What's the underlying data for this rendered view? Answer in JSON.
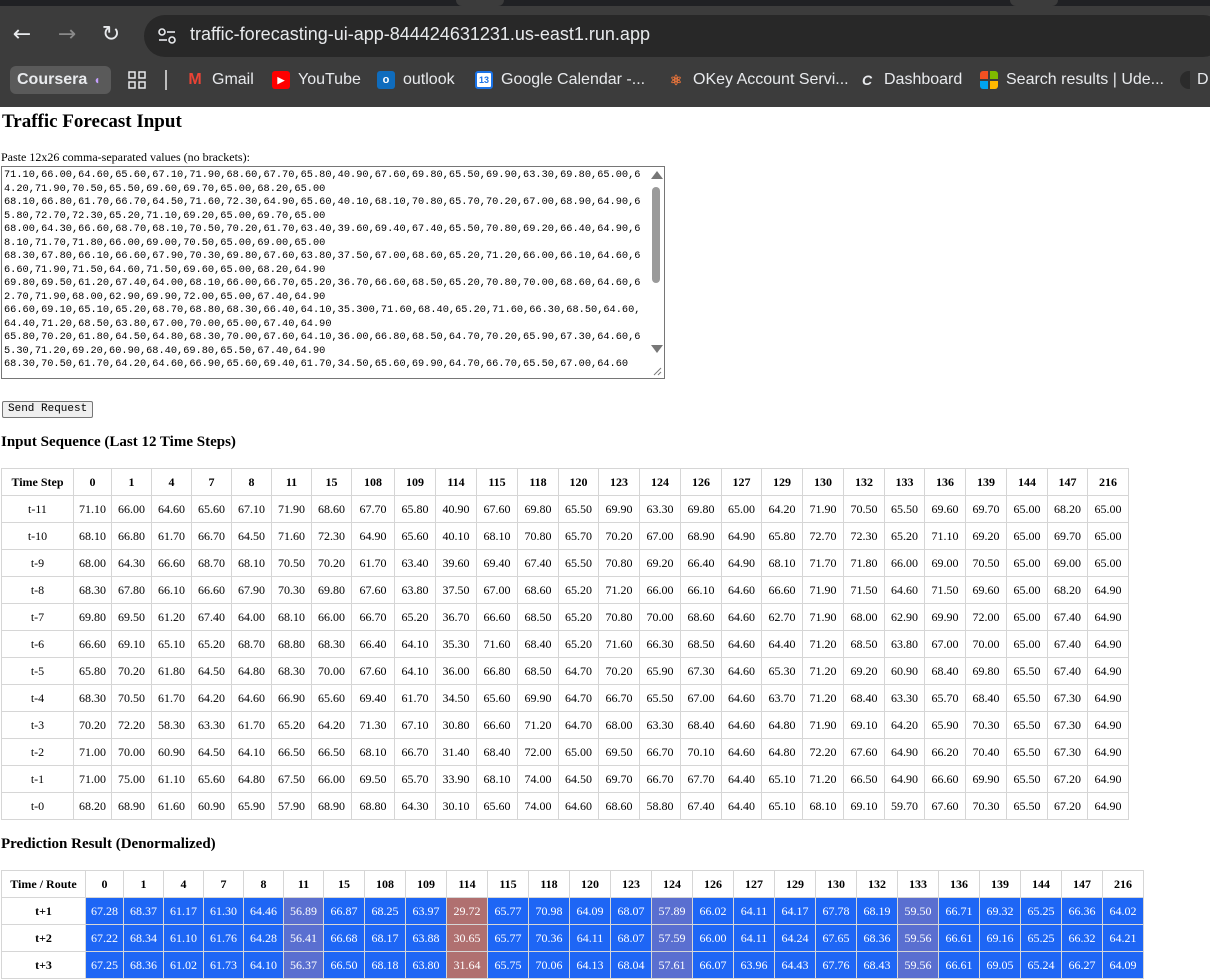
{
  "browser": {
    "url": "traffic-forecasting-ui-app-844424631231.us-east1.run.app",
    "bookmarks": [
      {
        "label": "Coursera",
        "icon": "coursera-icon"
      },
      {
        "label": "",
        "icon": "apps-grid-icon"
      },
      {
        "label": "Gmail",
        "icon": "gmail-icon"
      },
      {
        "label": "YouTube",
        "icon": "youtube-icon"
      },
      {
        "label": "outlook",
        "icon": "outlook-icon"
      },
      {
        "label": "Google Calendar -...",
        "icon": "calendar-icon"
      },
      {
        "label": "OKey Account Servi...",
        "icon": "okey-icon"
      },
      {
        "label": "Dashboard",
        "icon": "canvas-icon"
      },
      {
        "label": "Search results | Ude...",
        "icon": "microsoft-icon"
      },
      {
        "label": "D",
        "icon": "bookmark-icon"
      }
    ]
  },
  "page": {
    "title": "Traffic Forecast Input",
    "paste_label": "Paste 12x26 comma-separated values (no brackets):",
    "textarea_value": "71.10,66.00,64.60,65.60,67.10,71.90,68.60,67.70,65.80,40.90,67.60,69.80,65.50,69.90,63.30,69.80,65.00,64.20,71.90,70.50,65.50,69.60,69.70,65.00,68.20,65.00\n68.10,66.80,61.70,66.70,64.50,71.60,72.30,64.90,65.60,40.10,68.10,70.80,65.70,70.20,67.00,68.90,64.90,65.80,72.70,72.30,65.20,71.10,69.20,65.00,69.70,65.00\n68.00,64.30,66.60,68.70,68.10,70.50,70.20,61.70,63.40,39.60,69.40,67.40,65.50,70.80,69.20,66.40,64.90,68.10,71.70,71.80,66.00,69.00,70.50,65.00,69.00,65.00\n68.30,67.80,66.10,66.60,67.90,70.30,69.80,67.60,63.80,37.50,67.00,68.60,65.20,71.20,66.00,66.10,64.60,66.60,71.90,71.50,64.60,71.50,69.60,65.00,68.20,64.90\n69.80,69.50,61.20,67.40,64.00,68.10,66.00,66.70,65.20,36.70,66.60,68.50,65.20,70.80,70.00,68.60,64.60,62.70,71.90,68.00,62.90,69.90,72.00,65.00,67.40,64.90\n66.60,69.10,65.10,65.20,68.70,68.80,68.30,66.40,64.10,35.300,71.60,68.40,65.20,71.60,66.30,68.50,64.60,64.40,71.20,68.50,63.80,67.00,70.00,65.00,67.40,64.90\n65.80,70.20,61.80,64.50,64.80,68.30,70.00,67.60,64.10,36.00,66.80,68.50,64.70,70.20,65.90,67.30,64.60,65.30,71.20,69.20,60.90,68.40,69.80,65.50,67.40,64.90\n68.30,70.50,61.70,64.20,64.60,66.90,65.60,69.40,61.70,34.50,65.60,69.90,64.70,66.70,65.50,67.00,64.60",
    "send_label": "Send Request",
    "input_heading": "Input Sequence (Last 12 Time Steps)",
    "prediction_heading": "Prediction Result (Denormalized)"
  },
  "input_table": {
    "corner": "Time Step",
    "columns": [
      "0",
      "1",
      "4",
      "7",
      "8",
      "11",
      "15",
      "108",
      "109",
      "114",
      "115",
      "118",
      "120",
      "123",
      "124",
      "126",
      "127",
      "129",
      "130",
      "132",
      "133",
      "136",
      "139",
      "144",
      "147",
      "216"
    ],
    "rows": [
      {
        "label": "t-11",
        "values": [
          "71.10",
          "66.00",
          "64.60",
          "65.60",
          "67.10",
          "71.90",
          "68.60",
          "67.70",
          "65.80",
          "40.90",
          "67.60",
          "69.80",
          "65.50",
          "69.90",
          "63.30",
          "69.80",
          "65.00",
          "64.20",
          "71.90",
          "70.50",
          "65.50",
          "69.60",
          "69.70",
          "65.00",
          "68.20",
          "65.00"
        ]
      },
      {
        "label": "t-10",
        "values": [
          "68.10",
          "66.80",
          "61.70",
          "66.70",
          "64.50",
          "71.60",
          "72.30",
          "64.90",
          "65.60",
          "40.10",
          "68.10",
          "70.80",
          "65.70",
          "70.20",
          "67.00",
          "68.90",
          "64.90",
          "65.80",
          "72.70",
          "72.30",
          "65.20",
          "71.10",
          "69.20",
          "65.00",
          "69.70",
          "65.00"
        ]
      },
      {
        "label": "t-9",
        "values": [
          "68.00",
          "64.30",
          "66.60",
          "68.70",
          "68.10",
          "70.50",
          "70.20",
          "61.70",
          "63.40",
          "39.60",
          "69.40",
          "67.40",
          "65.50",
          "70.80",
          "69.20",
          "66.40",
          "64.90",
          "68.10",
          "71.70",
          "71.80",
          "66.00",
          "69.00",
          "70.50",
          "65.00",
          "69.00",
          "65.00"
        ]
      },
      {
        "label": "t-8",
        "values": [
          "68.30",
          "67.80",
          "66.10",
          "66.60",
          "67.90",
          "70.30",
          "69.80",
          "67.60",
          "63.80",
          "37.50",
          "67.00",
          "68.60",
          "65.20",
          "71.20",
          "66.00",
          "66.10",
          "64.60",
          "66.60",
          "71.90",
          "71.50",
          "64.60",
          "71.50",
          "69.60",
          "65.00",
          "68.20",
          "64.90"
        ]
      },
      {
        "label": "t-7",
        "values": [
          "69.80",
          "69.50",
          "61.20",
          "67.40",
          "64.00",
          "68.10",
          "66.00",
          "66.70",
          "65.20",
          "36.70",
          "66.60",
          "68.50",
          "65.20",
          "70.80",
          "70.00",
          "68.60",
          "64.60",
          "62.70",
          "71.90",
          "68.00",
          "62.90",
          "69.90",
          "72.00",
          "65.00",
          "67.40",
          "64.90"
        ]
      },
      {
        "label": "t-6",
        "values": [
          "66.60",
          "69.10",
          "65.10",
          "65.20",
          "68.70",
          "68.80",
          "68.30",
          "66.40",
          "64.10",
          "35.30",
          "71.60",
          "68.40",
          "65.20",
          "71.60",
          "66.30",
          "68.50",
          "64.60",
          "64.40",
          "71.20",
          "68.50",
          "63.80",
          "67.00",
          "70.00",
          "65.00",
          "67.40",
          "64.90"
        ]
      },
      {
        "label": "t-5",
        "values": [
          "65.80",
          "70.20",
          "61.80",
          "64.50",
          "64.80",
          "68.30",
          "70.00",
          "67.60",
          "64.10",
          "36.00",
          "66.80",
          "68.50",
          "64.70",
          "70.20",
          "65.90",
          "67.30",
          "64.60",
          "65.30",
          "71.20",
          "69.20",
          "60.90",
          "68.40",
          "69.80",
          "65.50",
          "67.40",
          "64.90"
        ]
      },
      {
        "label": "t-4",
        "values": [
          "68.30",
          "70.50",
          "61.70",
          "64.20",
          "64.60",
          "66.90",
          "65.60",
          "69.40",
          "61.70",
          "34.50",
          "65.60",
          "69.90",
          "64.70",
          "66.70",
          "65.50",
          "67.00",
          "64.60",
          "63.70",
          "71.20",
          "68.40",
          "63.30",
          "65.70",
          "68.40",
          "65.50",
          "67.30",
          "64.90"
        ]
      },
      {
        "label": "t-3",
        "values": [
          "70.20",
          "72.20",
          "58.30",
          "63.30",
          "61.70",
          "65.20",
          "64.20",
          "71.30",
          "67.10",
          "30.80",
          "66.60",
          "71.20",
          "64.70",
          "68.00",
          "63.30",
          "68.40",
          "64.60",
          "64.80",
          "71.90",
          "69.10",
          "64.20",
          "65.90",
          "70.30",
          "65.50",
          "67.30",
          "64.90"
        ]
      },
      {
        "label": "t-2",
        "values": [
          "71.00",
          "70.00",
          "60.90",
          "64.50",
          "64.10",
          "66.50",
          "66.50",
          "68.10",
          "66.70",
          "31.40",
          "68.40",
          "72.00",
          "65.00",
          "69.50",
          "66.70",
          "70.10",
          "64.60",
          "64.80",
          "72.20",
          "67.60",
          "64.90",
          "66.20",
          "70.40",
          "65.50",
          "67.30",
          "64.90"
        ]
      },
      {
        "label": "t-1",
        "values": [
          "71.00",
          "75.00",
          "61.10",
          "65.60",
          "64.80",
          "67.50",
          "66.00",
          "69.50",
          "65.70",
          "33.90",
          "68.10",
          "74.00",
          "64.50",
          "69.70",
          "66.70",
          "67.70",
          "64.40",
          "65.10",
          "71.20",
          "66.50",
          "64.90",
          "66.60",
          "69.90",
          "65.50",
          "67.20",
          "64.90"
        ]
      },
      {
        "label": "t-0",
        "values": [
          "68.20",
          "68.90",
          "61.60",
          "60.90",
          "65.90",
          "57.90",
          "68.90",
          "68.80",
          "64.30",
          "30.10",
          "65.60",
          "74.00",
          "64.60",
          "68.60",
          "58.80",
          "67.40",
          "64.40",
          "65.10",
          "68.10",
          "69.10",
          "59.70",
          "67.60",
          "70.30",
          "65.50",
          "67.20",
          "64.90"
        ]
      }
    ]
  },
  "prediction_table": {
    "corner": "Time / Route",
    "columns": [
      "0",
      "1",
      "4",
      "7",
      "8",
      "11",
      "15",
      "108",
      "109",
      "114",
      "115",
      "118",
      "120",
      "123",
      "124",
      "126",
      "127",
      "129",
      "130",
      "132",
      "133",
      "136",
      "139",
      "144",
      "147",
      "216"
    ],
    "rows": [
      {
        "label": "t+1",
        "values": [
          "67.28",
          "68.37",
          "61.17",
          "61.30",
          "64.46",
          "56.89",
          "66.87",
          "68.25",
          "63.97",
          "29.72",
          "65.77",
          "70.98",
          "64.09",
          "68.07",
          "57.89",
          "66.02",
          "64.11",
          "64.17",
          "67.78",
          "68.19",
          "59.50",
          "66.71",
          "69.32",
          "65.25",
          "66.36",
          "64.02"
        ]
      },
      {
        "label": "t+2",
        "values": [
          "67.22",
          "68.34",
          "61.10",
          "61.76",
          "64.28",
          "56.41",
          "66.68",
          "68.17",
          "63.88",
          "30.65",
          "65.77",
          "70.36",
          "64.11",
          "68.07",
          "57.59",
          "66.00",
          "64.11",
          "64.24",
          "67.65",
          "68.36",
          "59.56",
          "66.61",
          "69.16",
          "65.25",
          "66.32",
          "64.21"
        ]
      },
      {
        "label": "t+3",
        "values": [
          "67.25",
          "68.36",
          "61.02",
          "61.73",
          "64.10",
          "56.37",
          "66.50",
          "68.18",
          "63.80",
          "31.64",
          "65.75",
          "70.06",
          "64.13",
          "68.04",
          "57.61",
          "66.07",
          "63.96",
          "64.43",
          "67.76",
          "68.43",
          "59.56",
          "66.61",
          "69.05",
          "65.24",
          "66.27",
          "64.09"
        ]
      }
    ],
    "colors": {
      "high": "#1e66f5",
      "mid": "#5a6fd0",
      "low": "#b07070"
    }
  }
}
